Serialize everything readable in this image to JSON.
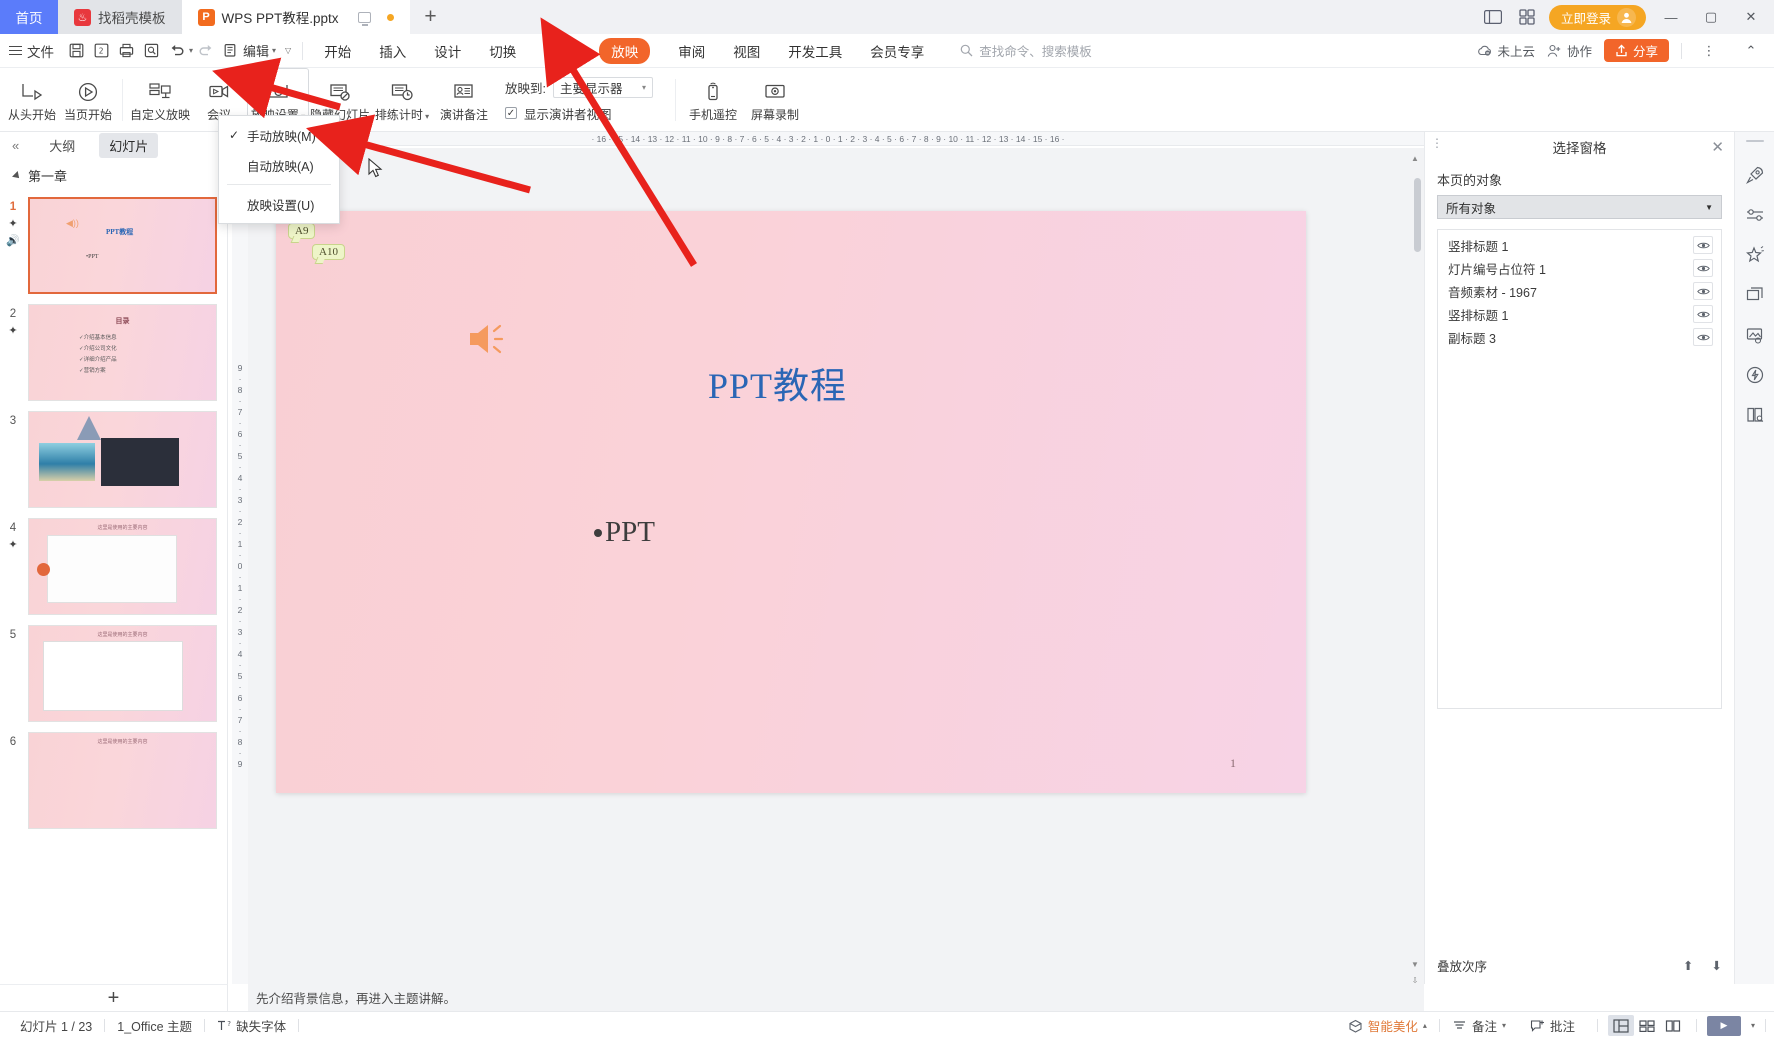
{
  "window": {
    "tabs": [
      {
        "label": "首页",
        "type": "home"
      },
      {
        "label": "找稻壳模板",
        "type": "gray",
        "icon": "docer-icon"
      },
      {
        "label": "WPS PPT教程.pptx",
        "type": "active",
        "icon": "wps-ppt-icon"
      }
    ],
    "add_tab": "+",
    "login_label": "立即登录",
    "minimize": "—",
    "maximize": "▢",
    "close": "✕"
  },
  "menubar": {
    "file_label": "文件",
    "quick_icons": [
      "save-icon",
      "save-as-icon",
      "print-icon",
      "print-preview-icon",
      "undo-icon",
      "redo-icon",
      "format-painter-icon"
    ],
    "edit_label": "编辑",
    "tabs": [
      {
        "label": "开始",
        "active": false
      },
      {
        "label": "插入",
        "active": false
      },
      {
        "label": "设计",
        "active": false
      },
      {
        "label": "切换",
        "active": false
      },
      {
        "label": "动画",
        "active": false
      },
      {
        "label": "放映",
        "active": true
      },
      {
        "label": "审阅",
        "active": false
      },
      {
        "label": "视图",
        "active": false
      },
      {
        "label": "开发工具",
        "active": false
      },
      {
        "label": "会员专享",
        "active": false
      }
    ],
    "search_placeholder": "查找命令、搜索模板",
    "cloud_label": "未上云",
    "collab_label": "协作",
    "share_label": "分享",
    "accent_color": "#f2652a"
  },
  "ribbon": {
    "buttons": [
      {
        "label": "从头开始",
        "icon": "start-from-beginning-icon"
      },
      {
        "label": "当页开始",
        "icon": "start-from-current-icon"
      },
      {
        "label": "自定义放映",
        "icon": "custom-show-icon"
      },
      {
        "label": "会议",
        "icon": "meeting-icon"
      },
      {
        "label": "放映设置",
        "icon": "show-settings-icon",
        "selected": true,
        "has_caret": true
      },
      {
        "label": "隐藏幻灯片",
        "icon": "hide-slide-icon"
      },
      {
        "label": "排练计时",
        "icon": "rehearse-timing-icon",
        "has_caret": true
      },
      {
        "label": "演讲备注",
        "icon": "presenter-notes-icon"
      }
    ],
    "project_to_label": "放映到:",
    "project_to_value": "主要显示器",
    "presenter_view_label": "显示演讲者视图",
    "presenter_view_checked": true,
    "phone_remote": "手机遥控",
    "screen_record": "屏幕录制"
  },
  "dropdown": {
    "items": [
      {
        "label": "手动放映(M)",
        "checked": true
      },
      {
        "label": "自动放映(A)",
        "checked": false
      },
      {
        "label": "放映设置(U)",
        "checked": false,
        "separator_before": true
      }
    ]
  },
  "left_pane": {
    "collapse_icon": "«",
    "tabs": [
      {
        "label": "大纲",
        "active": false
      },
      {
        "label": "幻灯片",
        "active": true
      }
    ],
    "section_title": "第一章",
    "slides": [
      {
        "number": "1",
        "selected": true,
        "icons": [
          "animation-star-icon",
          "audio-icon"
        ]
      },
      {
        "number": "2",
        "selected": false,
        "icons": [
          "animation-star-icon"
        ]
      },
      {
        "number": "3",
        "selected": false,
        "icons": []
      },
      {
        "number": "4",
        "selected": false,
        "icons": [
          "animation-star-icon"
        ]
      },
      {
        "number": "5",
        "selected": false,
        "icons": []
      },
      {
        "number": "6",
        "selected": false,
        "icons": []
      }
    ],
    "add_slide": "+"
  },
  "rulers": {
    "horizontal": "· 16 · 15 · 14 · 13 · 12 · 11 · 10 · 9 · 8 · 7 · 6 · 5 · 4 · 3 · 2 · 1 · 0 · 1 · 2 · 3 · 4 · 5 · 6 · 7 · 8 · 9 · 10 · 11 · 12 · 13 · 14 · 15 · 16 ·",
    "vertical": [
      "9",
      "8",
      "7",
      "6",
      "5",
      "4",
      "3",
      "2",
      "1",
      "0",
      "1",
      "2",
      "3",
      "4",
      "5",
      "6",
      "7",
      "8",
      "9"
    ]
  },
  "slide": {
    "tags": [
      {
        "label": "A9"
      },
      {
        "label": "A10"
      }
    ],
    "audio_icon": "speaker-icon",
    "title": "PPT教程",
    "title_color": "#2a66b5",
    "bullet_text": "PPT",
    "page_number": "1",
    "background_colors": [
      "#f9cfd4",
      "#f7d3e6"
    ]
  },
  "notes": {
    "text": "先介绍背景信息，再进入主题讲解。"
  },
  "right_panel": {
    "title": "选择窗格",
    "close": "✕",
    "subtitle": "本页的对象",
    "filter_value": "所有对象",
    "objects": [
      {
        "label": "竖排标题 1"
      },
      {
        "label": "灯片编号占位符 1"
      },
      {
        "label": "音频素材 - 1967"
      },
      {
        "label": "竖排标题 1"
      },
      {
        "label": "副标题 3"
      }
    ],
    "footer_label": "叠放次序"
  },
  "rail": {
    "icons": [
      {
        "name": "rocket-icon"
      },
      {
        "name": "settings-sliders-icon"
      },
      {
        "name": "magic-star-icon"
      },
      {
        "name": "duplicate-shape-icon"
      },
      {
        "name": "image-edit-icon"
      },
      {
        "name": "lightning-shield-icon"
      },
      {
        "name": "book-search-icon"
      }
    ]
  },
  "statusbar": {
    "slide_counter": "幻灯片 1 / 23",
    "theme": "1_Office 主题",
    "missing_font": "缺失字体",
    "beautify": "智能美化",
    "notes_btn": "备注",
    "comment_btn": "批注",
    "views": [
      {
        "name": "normal-view",
        "active": true
      },
      {
        "name": "slide-sorter-view",
        "active": false
      },
      {
        "name": "reading-view",
        "active": false
      }
    ],
    "play_label": "▶"
  }
}
